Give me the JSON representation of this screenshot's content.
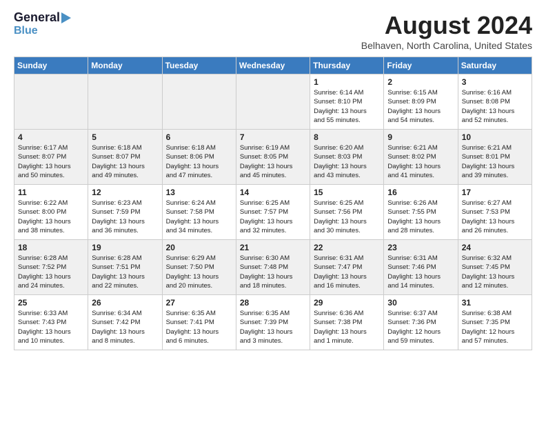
{
  "header": {
    "logo_line1": "General",
    "logo_line2": "Blue",
    "month_title": "August 2024",
    "location": "Belhaven, North Carolina, United States"
  },
  "weekdays": [
    "Sunday",
    "Monday",
    "Tuesday",
    "Wednesday",
    "Thursday",
    "Friday",
    "Saturday"
  ],
  "weeks": [
    [
      {
        "day": "",
        "content": ""
      },
      {
        "day": "",
        "content": ""
      },
      {
        "day": "",
        "content": ""
      },
      {
        "day": "",
        "content": ""
      },
      {
        "day": "1",
        "content": "Sunrise: 6:14 AM\nSunset: 8:10 PM\nDaylight: 13 hours\nand 55 minutes."
      },
      {
        "day": "2",
        "content": "Sunrise: 6:15 AM\nSunset: 8:09 PM\nDaylight: 13 hours\nand 54 minutes."
      },
      {
        "day": "3",
        "content": "Sunrise: 6:16 AM\nSunset: 8:08 PM\nDaylight: 13 hours\nand 52 minutes."
      }
    ],
    [
      {
        "day": "4",
        "content": "Sunrise: 6:17 AM\nSunset: 8:07 PM\nDaylight: 13 hours\nand 50 minutes."
      },
      {
        "day": "5",
        "content": "Sunrise: 6:18 AM\nSunset: 8:07 PM\nDaylight: 13 hours\nand 49 minutes."
      },
      {
        "day": "6",
        "content": "Sunrise: 6:18 AM\nSunset: 8:06 PM\nDaylight: 13 hours\nand 47 minutes."
      },
      {
        "day": "7",
        "content": "Sunrise: 6:19 AM\nSunset: 8:05 PM\nDaylight: 13 hours\nand 45 minutes."
      },
      {
        "day": "8",
        "content": "Sunrise: 6:20 AM\nSunset: 8:03 PM\nDaylight: 13 hours\nand 43 minutes."
      },
      {
        "day": "9",
        "content": "Sunrise: 6:21 AM\nSunset: 8:02 PM\nDaylight: 13 hours\nand 41 minutes."
      },
      {
        "day": "10",
        "content": "Sunrise: 6:21 AM\nSunset: 8:01 PM\nDaylight: 13 hours\nand 39 minutes."
      }
    ],
    [
      {
        "day": "11",
        "content": "Sunrise: 6:22 AM\nSunset: 8:00 PM\nDaylight: 13 hours\nand 38 minutes."
      },
      {
        "day": "12",
        "content": "Sunrise: 6:23 AM\nSunset: 7:59 PM\nDaylight: 13 hours\nand 36 minutes."
      },
      {
        "day": "13",
        "content": "Sunrise: 6:24 AM\nSunset: 7:58 PM\nDaylight: 13 hours\nand 34 minutes."
      },
      {
        "day": "14",
        "content": "Sunrise: 6:25 AM\nSunset: 7:57 PM\nDaylight: 13 hours\nand 32 minutes."
      },
      {
        "day": "15",
        "content": "Sunrise: 6:25 AM\nSunset: 7:56 PM\nDaylight: 13 hours\nand 30 minutes."
      },
      {
        "day": "16",
        "content": "Sunrise: 6:26 AM\nSunset: 7:55 PM\nDaylight: 13 hours\nand 28 minutes."
      },
      {
        "day": "17",
        "content": "Sunrise: 6:27 AM\nSunset: 7:53 PM\nDaylight: 13 hours\nand 26 minutes."
      }
    ],
    [
      {
        "day": "18",
        "content": "Sunrise: 6:28 AM\nSunset: 7:52 PM\nDaylight: 13 hours\nand 24 minutes."
      },
      {
        "day": "19",
        "content": "Sunrise: 6:28 AM\nSunset: 7:51 PM\nDaylight: 13 hours\nand 22 minutes."
      },
      {
        "day": "20",
        "content": "Sunrise: 6:29 AM\nSunset: 7:50 PM\nDaylight: 13 hours\nand 20 minutes."
      },
      {
        "day": "21",
        "content": "Sunrise: 6:30 AM\nSunset: 7:48 PM\nDaylight: 13 hours\nand 18 minutes."
      },
      {
        "day": "22",
        "content": "Sunrise: 6:31 AM\nSunset: 7:47 PM\nDaylight: 13 hours\nand 16 minutes."
      },
      {
        "day": "23",
        "content": "Sunrise: 6:31 AM\nSunset: 7:46 PM\nDaylight: 13 hours\nand 14 minutes."
      },
      {
        "day": "24",
        "content": "Sunrise: 6:32 AM\nSunset: 7:45 PM\nDaylight: 13 hours\nand 12 minutes."
      }
    ],
    [
      {
        "day": "25",
        "content": "Sunrise: 6:33 AM\nSunset: 7:43 PM\nDaylight: 13 hours\nand 10 minutes."
      },
      {
        "day": "26",
        "content": "Sunrise: 6:34 AM\nSunset: 7:42 PM\nDaylight: 13 hours\nand 8 minutes."
      },
      {
        "day": "27",
        "content": "Sunrise: 6:35 AM\nSunset: 7:41 PM\nDaylight: 13 hours\nand 6 minutes."
      },
      {
        "day": "28",
        "content": "Sunrise: 6:35 AM\nSunset: 7:39 PM\nDaylight: 13 hours\nand 3 minutes."
      },
      {
        "day": "29",
        "content": "Sunrise: 6:36 AM\nSunset: 7:38 PM\nDaylight: 13 hours\nand 1 minute."
      },
      {
        "day": "30",
        "content": "Sunrise: 6:37 AM\nSunset: 7:36 PM\nDaylight: 12 hours\nand 59 minutes."
      },
      {
        "day": "31",
        "content": "Sunrise: 6:38 AM\nSunset: 7:35 PM\nDaylight: 12 hours\nand 57 minutes."
      }
    ]
  ]
}
